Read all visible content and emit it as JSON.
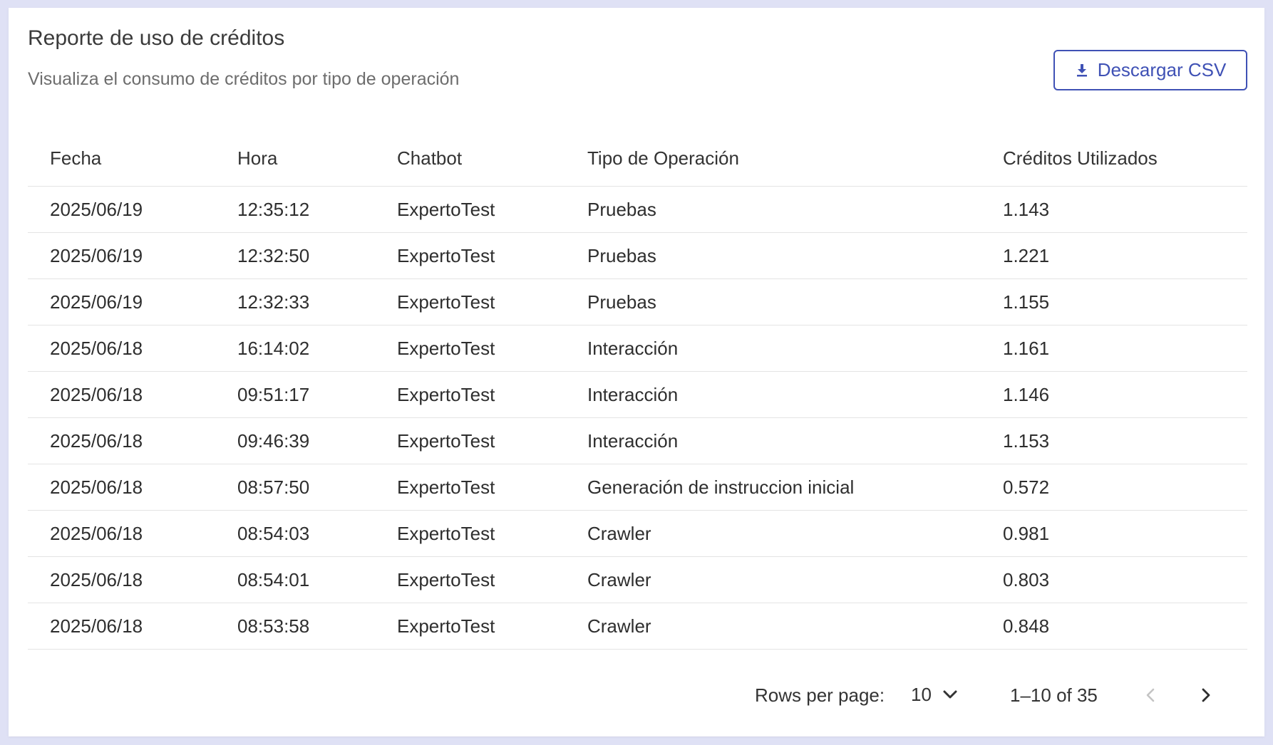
{
  "header": {
    "title": "Reporte de uso de créditos",
    "subtitle": "Visualiza el consumo de créditos por tipo de operación",
    "download_label": "Descargar CSV"
  },
  "table": {
    "columns": [
      "Fecha",
      "Hora",
      "Chatbot",
      "Tipo de Operación",
      "Créditos Utilizados"
    ],
    "rows": [
      [
        "2025/06/19",
        "12:35:12",
        "ExpertoTest",
        "Pruebas",
        "1.143"
      ],
      [
        "2025/06/19",
        "12:32:50",
        "ExpertoTest",
        "Pruebas",
        "1.221"
      ],
      [
        "2025/06/19",
        "12:32:33",
        "ExpertoTest",
        "Pruebas",
        "1.155"
      ],
      [
        "2025/06/18",
        "16:14:02",
        "ExpertoTest",
        "Interacción",
        "1.161"
      ],
      [
        "2025/06/18",
        "09:51:17",
        "ExpertoTest",
        "Interacción",
        "1.146"
      ],
      [
        "2025/06/18",
        "09:46:39",
        "ExpertoTest",
        "Interacción",
        "1.153"
      ],
      [
        "2025/06/18",
        "08:57:50",
        "ExpertoTest",
        "Generación de instruccion inicial",
        "0.572"
      ],
      [
        "2025/06/18",
        "08:54:03",
        "ExpertoTest",
        "Crawler",
        "0.981"
      ],
      [
        "2025/06/18",
        "08:54:01",
        "ExpertoTest",
        "Crawler",
        "0.803"
      ],
      [
        "2025/06/18",
        "08:53:58",
        "ExpertoTest",
        "Crawler",
        "0.848"
      ]
    ]
  },
  "pagination": {
    "rows_per_page_label": "Rows per page:",
    "rows_per_page_value": "10",
    "range_label": "1–10 of 35"
  },
  "colors": {
    "accent": "#3f51b5",
    "page_background": "#dfe1f5",
    "card_background": "#ffffff"
  },
  "icons": {
    "download": "download-icon",
    "dropdown": "chevron-down-icon",
    "previous": "chevron-left-icon",
    "next": "chevron-right-icon"
  }
}
